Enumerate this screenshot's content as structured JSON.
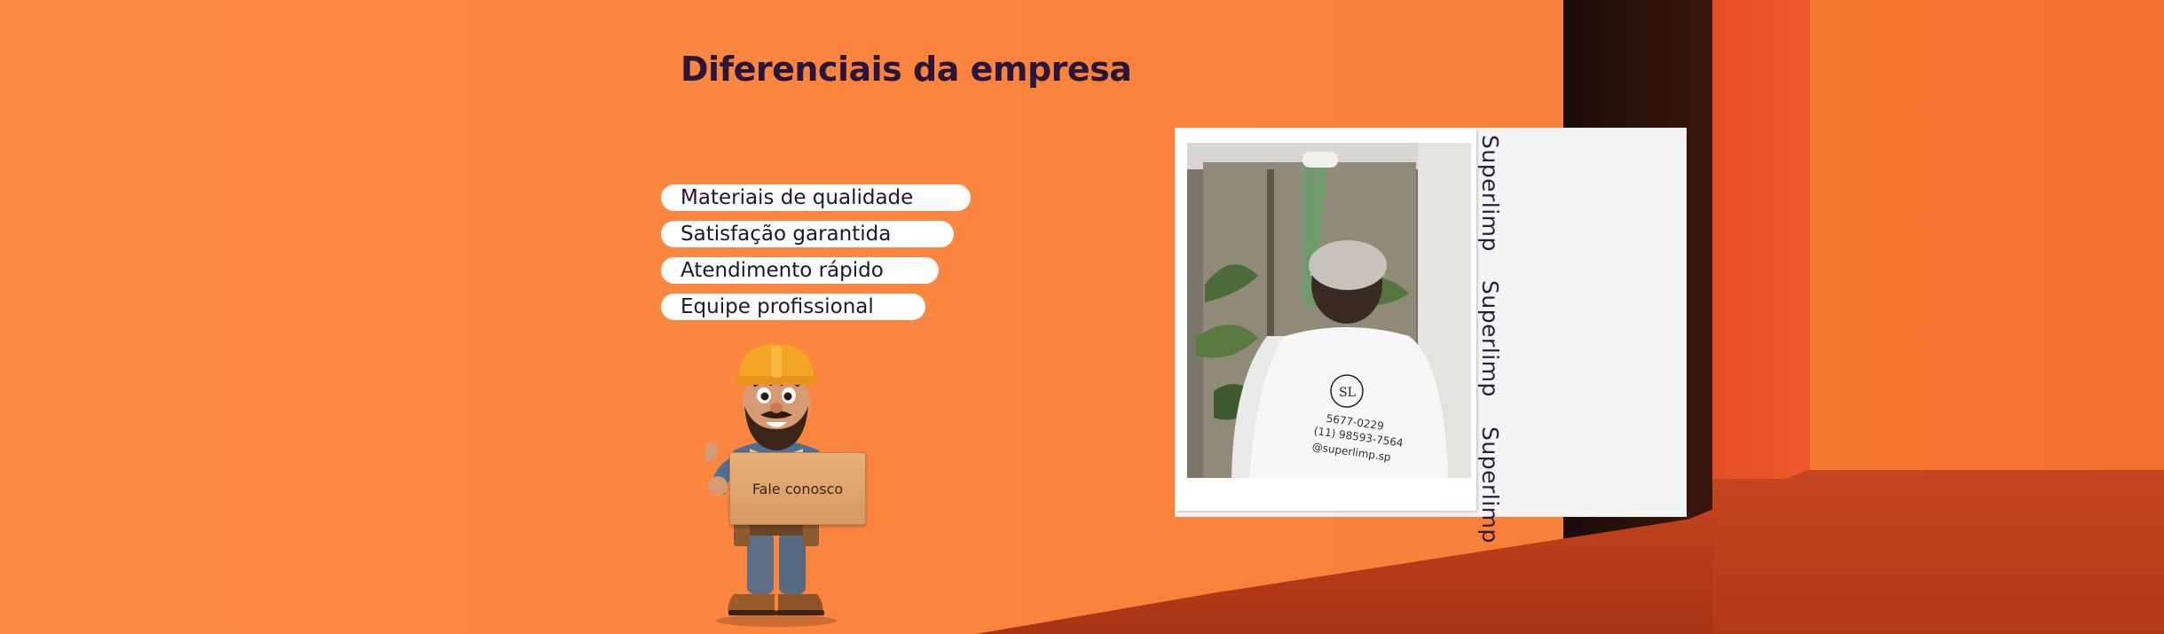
{
  "section": {
    "title": "Diferenciais da empresa"
  },
  "features": [
    "Materiais de qualidade",
    "Satisfação garantida",
    "Atendimento rápido",
    "Equipe profissional"
  ],
  "mascot": {
    "sign_label": "Fale conosco"
  },
  "gallery": {
    "caption_words": [
      "Superlimp",
      "Superlimp",
      "Superlimp"
    ],
    "shirt_text": {
      "line1": "5677-0229",
      "line2": "(11) 98593-7564",
      "line3": "@superlimp.sp",
      "monogram": "SL"
    }
  },
  "colors": {
    "background": "#fb8640",
    "heading": "#2a1638",
    "pill": "#ffffff",
    "card": "#f4f4f4"
  }
}
